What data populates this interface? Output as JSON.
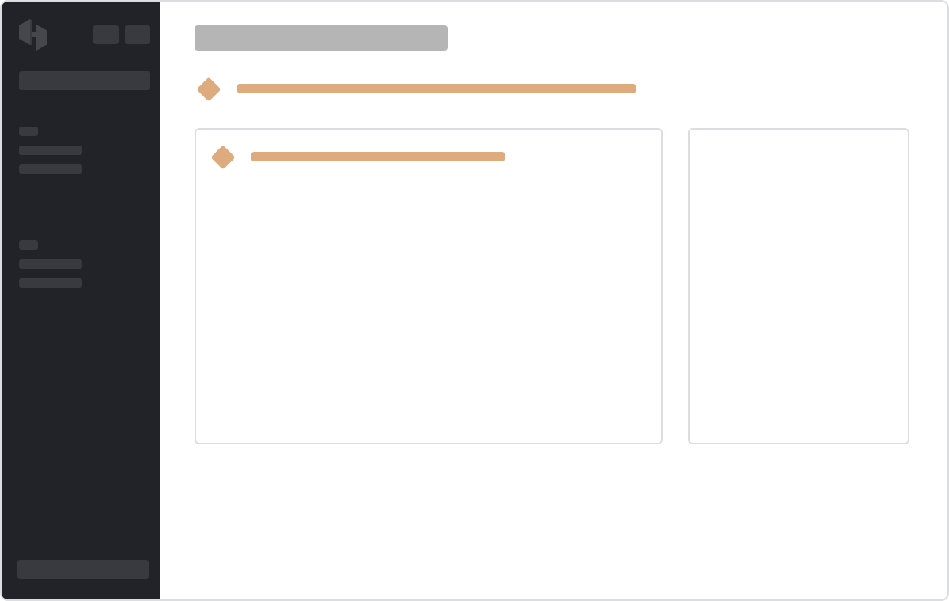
{
  "colors": {
    "sidebar_bg": "#212328",
    "sidebar_skeleton": "#383a40",
    "title_skeleton": "#b5b5b5",
    "accent": "#deab7e",
    "card_border": "#dcdde0",
    "background": "#ffffff"
  },
  "sidebar": {
    "logo_icon": "hashicorp-logo-icon",
    "header_buttons": 2,
    "sections": [
      {
        "links": 2
      },
      {
        "links": 2
      }
    ]
  },
  "main": {
    "alert_icon": "warning-diamond-icon",
    "cards": [
      {
        "icon": "warning-diamond-icon"
      },
      {
        "icon": null
      }
    ]
  }
}
